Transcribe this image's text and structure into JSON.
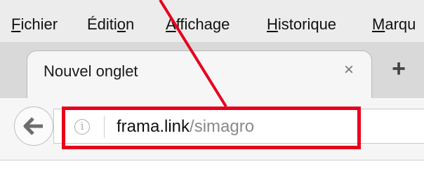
{
  "menubar": {
    "items": [
      {
        "pre": "",
        "u": "F",
        "post": "ichier"
      },
      {
        "pre": "Éditi",
        "u": "o",
        "post": "n"
      },
      {
        "pre": "",
        "u": "A",
        "post": "ffichage"
      },
      {
        "pre": "",
        "u": "H",
        "post": "istorique"
      },
      {
        "pre": "",
        "u": "M",
        "post": "arqu"
      }
    ]
  },
  "tab": {
    "title": "Nouvel onglet",
    "close_glyph": "×",
    "new_tab_glyph": "+"
  },
  "urlbar": {
    "info_glyph": "i",
    "domain": "frama.link",
    "path": "/simagro"
  },
  "annotation": {
    "color": "#e8001c"
  }
}
